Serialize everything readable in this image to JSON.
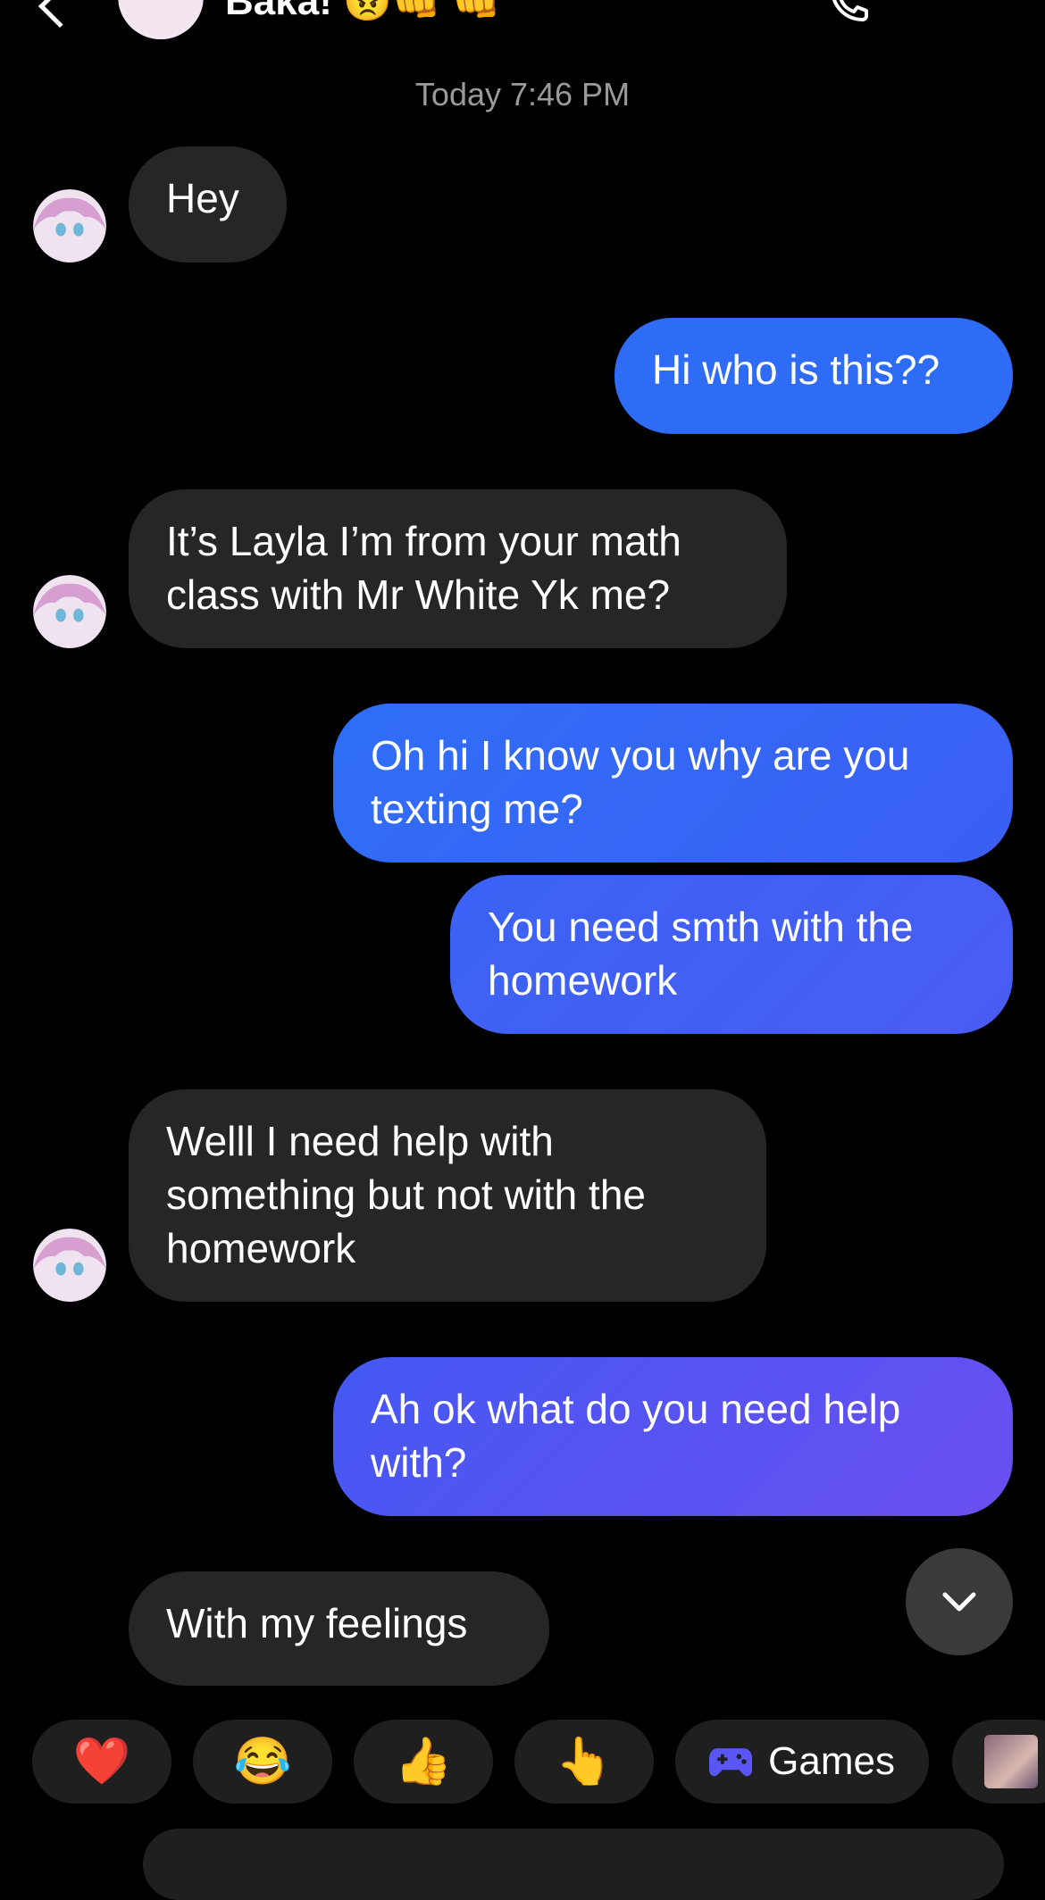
{
  "header": {
    "title": "Baka! 😠👊 👊",
    "icons": [
      "back-icon",
      "avatar",
      "call-icon",
      "more-icon"
    ]
  },
  "timestamp": "Today 7:46 PM",
  "messages": [
    {
      "side": "in",
      "text": "Hey"
    },
    {
      "side": "out",
      "text": "Hi who is this??"
    },
    {
      "side": "in",
      "text": "It’s Layla I’m from your math\nclass with Mr White Yk me?"
    },
    {
      "side": "out",
      "text": "Oh hi I know you why are you\ntexting me?"
    },
    {
      "side": "out",
      "text": "You need smth with the\nhomework"
    },
    {
      "side": "in",
      "text": "Welll I need help with\nsomething but not with the\nhomework"
    },
    {
      "side": "out",
      "text": "Ah ok what do you need help\nwith?"
    },
    {
      "side": "in",
      "text": "With my feelings"
    }
  ],
  "quick_replies": [
    {
      "emoji": "❤️",
      "icon": "heart-icon"
    },
    {
      "emoji": "😂",
      "icon": "laughing-icon"
    },
    {
      "emoji": "👍",
      "icon": "thumbs-up-icon"
    },
    {
      "emoji": "👆",
      "icon": "pointing-hand-icon"
    },
    {
      "label": "Games",
      "icon": "gamepad-icon"
    }
  ],
  "colors": {
    "background": "#000000",
    "incoming_bubble": "#262626",
    "outgoing_start": "#2f6cf6",
    "outgoing_end": "#6a4ff0",
    "timestamp": "#9a9a9a"
  }
}
